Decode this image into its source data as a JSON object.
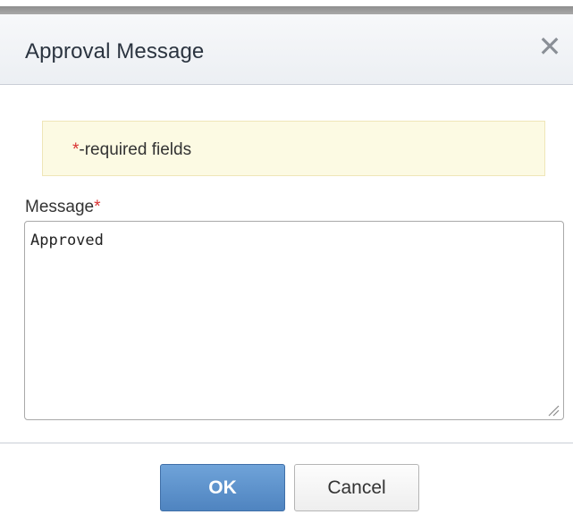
{
  "dialog": {
    "title": "Approval Message",
    "close_symbol": "✕"
  },
  "notice": {
    "asterisk": "*",
    "text": "-required fields"
  },
  "form": {
    "message_label": "Message",
    "required_marker": "*",
    "message_value": "Approved"
  },
  "buttons": {
    "ok_label": "OK",
    "cancel_label": "Cancel"
  },
  "icons": {
    "close": "close-icon",
    "resize": "resize-grip-icon"
  },
  "colors": {
    "required": "#d93232",
    "primary_button": "#5b8fca",
    "notice_background": "#fcfae3"
  }
}
